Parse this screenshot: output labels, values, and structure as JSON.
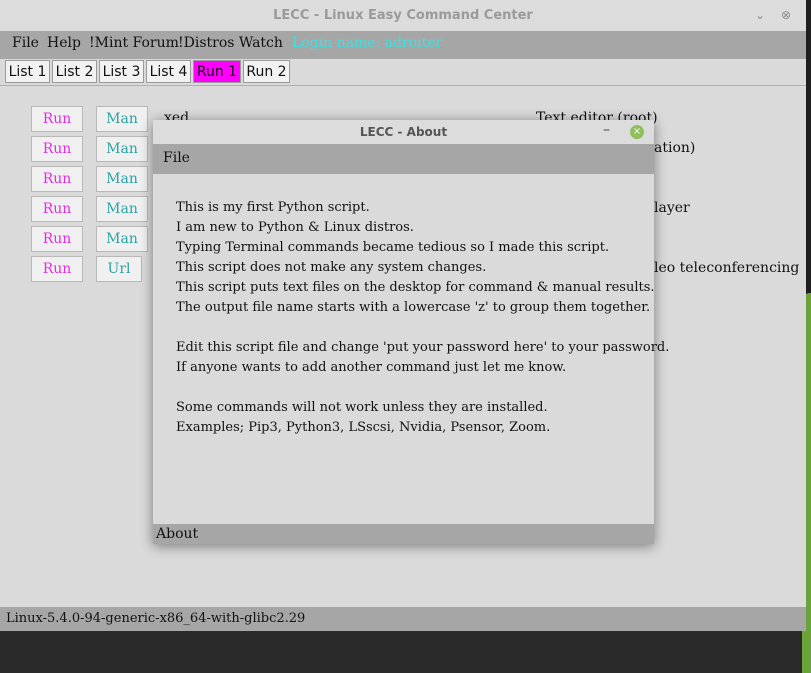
{
  "window": {
    "title": "LECC - Linux Easy Command Center",
    "minimize": "⌄",
    "close": "⊗"
  },
  "menu": {
    "file": "File",
    "help": "Help",
    "mint_forum": "!Mint Forum",
    "distros_watch": "!Distros Watch",
    "login": "Login name: adroiter"
  },
  "tabs": [
    {
      "label": "List 1"
    },
    {
      "label": "List 2"
    },
    {
      "label": "List 3"
    },
    {
      "label": "List 4"
    },
    {
      "label": "Run 1"
    },
    {
      "label": "Run 2"
    }
  ],
  "rows": [
    {
      "run": "Run",
      "man": "Man",
      "cmd": "xed",
      "desc": "Text editor (root)"
    },
    {
      "run": "Run",
      "man": "Man",
      "cmd": "",
      "desc": "ation)"
    },
    {
      "run": "Run",
      "man": "Man",
      "cmd": "",
      "desc": ""
    },
    {
      "run": "Run",
      "man": "Man",
      "cmd": "",
      "desc": "layer"
    },
    {
      "run": "Run",
      "man": "Man",
      "cmd": "",
      "desc": ""
    },
    {
      "run": "Run",
      "man": "Url",
      "cmd": "",
      "desc": "leo teleconferencing"
    }
  ],
  "status": "Linux-5.4.0-94-generic-x86_64-with-glibc2.29",
  "about": {
    "title": "LECC - About",
    "minimize": "–",
    "close": "×",
    "menu_file": "File",
    "lines": [
      "This is my first Python script.",
      "I am new to Python & Linux distros.",
      "Typing Terminal commands became tedious so I made this script.",
      "This script does not make any system changes.",
      "This script puts text files on the desktop for command & manual results.",
      "The output file name starts with a lowercase 'z' to group them together.",
      "",
      "Edit this script file and change 'put your password here' to your password.",
      "If anyone wants to add another command just let me know.",
      "",
      "Some commands will not work unless they are installed.",
      "Examples; Pip3, Python3, LSscsi, Nvidia, Psensor, Zoom."
    ],
    "status": "About"
  }
}
